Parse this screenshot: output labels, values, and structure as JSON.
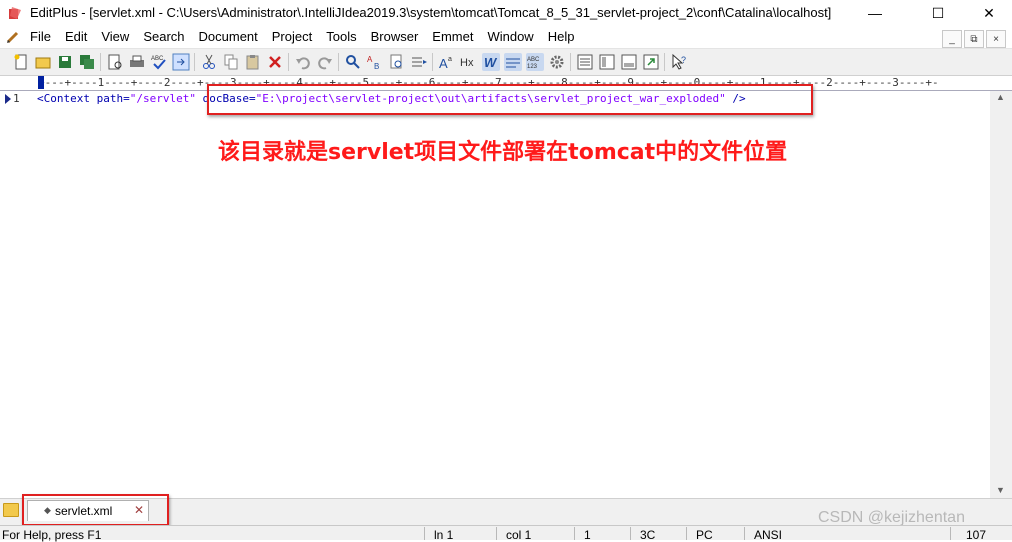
{
  "window": {
    "title": "EditPlus - [servlet.xml - C:\\Users\\Administrator\\.IntelliJIdea2019.3\\system\\tomcat\\Tomcat_8_5_31_servlet-project_2\\conf\\Catalina\\localhost]",
    "minimize_label": "—",
    "maximize_label": "☐",
    "close_label": "✕"
  },
  "menu": {
    "items": [
      "File",
      "Edit",
      "View",
      "Search",
      "Document",
      "Project",
      "Tools",
      "Browser",
      "Emmet",
      "Window",
      "Help"
    ],
    "mdi": [
      "_",
      "⧉",
      "×"
    ]
  },
  "ruler": {
    "text": "+---+----1----+----2----+----3----+----4----+----5----+----6----+----7----+----8----+----9----+----0----+----1----+----2----+----3----+-"
  },
  "editor": {
    "line_number": "1",
    "code": {
      "open": "<",
      "tag": "Context",
      "attr1": " path=",
      "val1": "\"/servlet\"",
      "attr2": " docBase=",
      "val2": "\"E:\\project\\servlet-project\\out\\artifacts\\servlet_project_war_exploded\"",
      "close": " />"
    }
  },
  "annotation": {
    "text": "该目录就是servlet项目文件部署在tomcat中的文件位置",
    "color": "#ff1a1a"
  },
  "tabs": [
    {
      "label": "servlet.xml",
      "close": "✕"
    }
  ],
  "watermark": "CSDN @kejizhentan",
  "statusbar": {
    "help": "For Help, press F1",
    "line": "ln 1",
    "col": "col 1",
    "lines": "1",
    "hex": "3C",
    "mode": "PC",
    "encoding": "ANSI",
    "size": "107"
  },
  "colors": {
    "highlight_box": "#e02020",
    "tag": "#0000b0",
    "string": "#8000ff"
  }
}
